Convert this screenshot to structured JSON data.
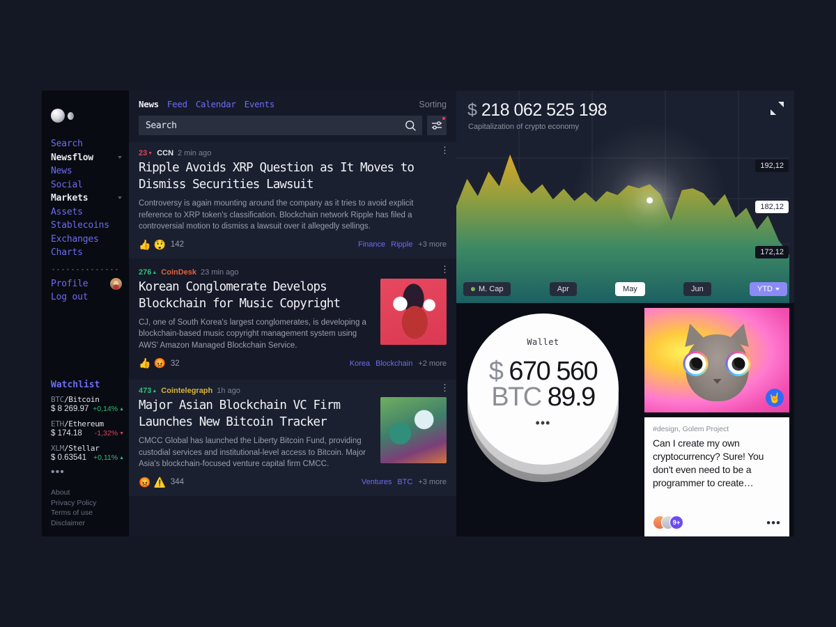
{
  "sidebar": {
    "logo_name": "app-logo",
    "nav": [
      {
        "label": "Search",
        "type": "link",
        "caret": false
      },
      {
        "label": "Newsflow",
        "type": "group",
        "caret": true
      },
      {
        "label": "News",
        "type": "link",
        "caret": false
      },
      {
        "label": "Social",
        "type": "link",
        "caret": false
      },
      {
        "label": "Markets",
        "type": "group",
        "caret": true
      },
      {
        "label": "Assets",
        "type": "link",
        "caret": false
      },
      {
        "label": "Stablecoins",
        "type": "link",
        "caret": false
      },
      {
        "label": "Exchanges",
        "type": "link",
        "caret": false
      },
      {
        "label": "Charts",
        "type": "link",
        "caret": false
      }
    ],
    "profile_label": "Profile",
    "logout_label": "Log out",
    "watchlist_title": "Watchlist",
    "watchlist": [
      {
        "symbol": "BTC",
        "name": "Bitcoin",
        "price": "$ 8 269.97",
        "change": "+0,14%",
        "dir": "up"
      },
      {
        "symbol": "ETH",
        "name": "Ethereum",
        "price": "$ 174.18",
        "change": "-1,32%",
        "dir": "down"
      },
      {
        "symbol": "XLM",
        "name": "Stellar",
        "price": "$ 0.63541",
        "change": "+0,11%",
        "dir": "up"
      }
    ],
    "watchlist_more": "•••",
    "footer": [
      "About",
      "Privacy Policy",
      "Terms of use",
      "Disclaimer"
    ]
  },
  "news": {
    "tabs": [
      {
        "label": "News",
        "active": true
      },
      {
        "label": "Feed",
        "active": false
      },
      {
        "label": "Calendar",
        "active": false
      },
      {
        "label": "Events",
        "active": false
      }
    ],
    "sorting_label": "Sorting",
    "search_placeholder": "Search",
    "search_value": "",
    "cards": [
      {
        "votes": "23",
        "votes_dir": "down",
        "source": "CCN",
        "source_color": "#e6e7ee",
        "time": "2 min ago",
        "headline": "Ripple Avoids XRP Question as It Moves to Dismiss Securities Lawsuit",
        "summary": "Controversy is again mounting around the company as it tries to avoid explicit reference to XRP token's classification. Blockchain network Ripple has filed a controversial motion to dismiss a lawsuit over it allegedly sellings.",
        "reactions": [
          "👍",
          "😲"
        ],
        "reaction_count": "142",
        "tags": [
          "Finance",
          "Ripple"
        ],
        "tags_more": "+3 more",
        "thumb": ""
      },
      {
        "votes": "276",
        "votes_dir": "up",
        "source": "CoinDesk",
        "source_color": "#e0613a",
        "time": "23 min ago",
        "headline": "Korean Conglomerate Develops Blockchain for Music Copyright",
        "summary": "CJ, one of South Korea's largest conglomerates, is developing a blockchain-based music copyright management system using AWS' Amazon Managed Blockchain Service.",
        "reactions": [
          "👍",
          "😡"
        ],
        "reaction_count": "32",
        "tags": [
          "Korea",
          "Blockchain"
        ],
        "tags_more": "+2 more",
        "thumb": "t1"
      },
      {
        "votes": "473",
        "votes_dir": "up",
        "source": "Cointelegraph",
        "source_color": "#d8b33a",
        "time": "1h ago",
        "headline": "Major Asian Blockchain VC Firm Launches New Bitcoin Tracker",
        "summary": "CMCC Global has launched the Liberty Bitcoin Fund, providing custodial services and institutional-level access to Bitcoin. Major Asia's blockchain-focused venture capital firm CMCC.",
        "reactions": [
          "😡",
          "⚠️"
        ],
        "reaction_count": "344",
        "tags": [
          "Ventures",
          "BTC"
        ],
        "tags_more": "+3 more",
        "thumb": "t2"
      }
    ]
  },
  "chart_panel": {
    "value": "218 062 525 198",
    "currency": "$",
    "subtitle": "Capitalization of crypto economy",
    "price_tags": [
      {
        "label": "192,12",
        "highlight": false
      },
      {
        "label": "182,12",
        "highlight": true
      },
      {
        "label": "172,12",
        "highlight": false
      }
    ],
    "legend_label": "M. Cap",
    "months": [
      {
        "label": "Apr",
        "active": false
      },
      {
        "label": "May",
        "active": true
      },
      {
        "label": "Jun",
        "active": false
      }
    ],
    "range_label": "YTD"
  },
  "chart_data": {
    "type": "area",
    "title": "Capitalization of crypto economy",
    "subtitle": "$ 218 062 525 198",
    "series_name": "M. Cap",
    "xlabel": "",
    "ylabel": "",
    "x_tick_labels": [
      "Apr",
      "May",
      "Jun"
    ],
    "y_tick_labels": [
      "192,12",
      "182,12",
      "172,12"
    ],
    "ylim": [
      165.0,
      196.0
    ],
    "grid": true,
    "legend_position": "bottom-left",
    "highlight_point": {
      "x_index": 18,
      "value": 182.12
    },
    "values": [
      181.0,
      186.5,
      183.0,
      188.0,
      185.0,
      191.5,
      186.0,
      183.5,
      185.4,
      182.3,
      184.5,
      182.0,
      183.8,
      181.8,
      184.0,
      183.2,
      185.2,
      184.6,
      185.4,
      183.4,
      178.0,
      184.2,
      184.6,
      183.6,
      181.0,
      183.4,
      178.6,
      180.6,
      176.2,
      179.0,
      174.0,
      171.0
    ]
  },
  "wallet": {
    "label": "Wallet",
    "currency": "$",
    "usd_amount": "670 560",
    "btc_symbol": "BTC",
    "btc_amount": "89.9",
    "more": "•••"
  },
  "media_card": {
    "name": "cat-image-card",
    "badge_glyph": "🤘"
  },
  "post_card": {
    "tag": "#design, Golem Project",
    "text": "Can I create my own cryptocurrency? Sure! You don't even need to be a programmer to create…",
    "avatar_count": "9+",
    "more": "•••"
  },
  "colors": {
    "accent": "#6c6cf2",
    "up": "#2fbe7c",
    "down": "#e0435a",
    "panel": "#1b2030",
    "news_bg": "#161a28",
    "sidebar_bg": "#090b12",
    "page_bg": "#141824"
  }
}
